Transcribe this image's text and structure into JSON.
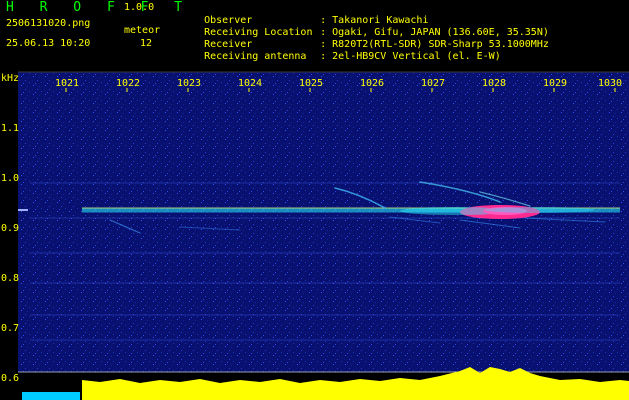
{
  "header": {
    "app_title": "H R O F F T",
    "version": "1.0.0",
    "file_name": "2506131020.png",
    "datetime": "25.06.13 10:20",
    "meteor_label": "meteor",
    "meteor_count": "12",
    "info": [
      {
        "key": "Observer",
        "value": ": Takanori Kawachi"
      },
      {
        "key": "Receiving Location",
        "value": ": Ogaki, Gifu, JAPAN (136.60E, 35.35N)"
      },
      {
        "key": "Receiver",
        "value": ": R820T2(RTL-SDR) SDR-Sharp 53.1000MHz"
      },
      {
        "key": "Receiving antenna",
        "value": ": 2el-HB9CV Vertical (el. E-W)"
      }
    ]
  },
  "axes": {
    "unit_label": "kHz",
    "y_ticks": [
      "1.1",
      "1.0",
      "0.9",
      "0.8",
      "0.7",
      "0.6"
    ],
    "x_ticks": [
      "1021",
      "1022",
      "1023",
      "1024",
      "1025",
      "1026",
      "1027",
      "1028",
      "1029",
      "1030"
    ]
  },
  "colors": {
    "background": "#000000",
    "header_text": "#ffff00",
    "title_text": "#00ff00",
    "noise": "#0a1a9a",
    "signal_core": "#ff2a7a",
    "power_bar": "#ffff00",
    "power_bar_low": "#00ccff"
  }
}
